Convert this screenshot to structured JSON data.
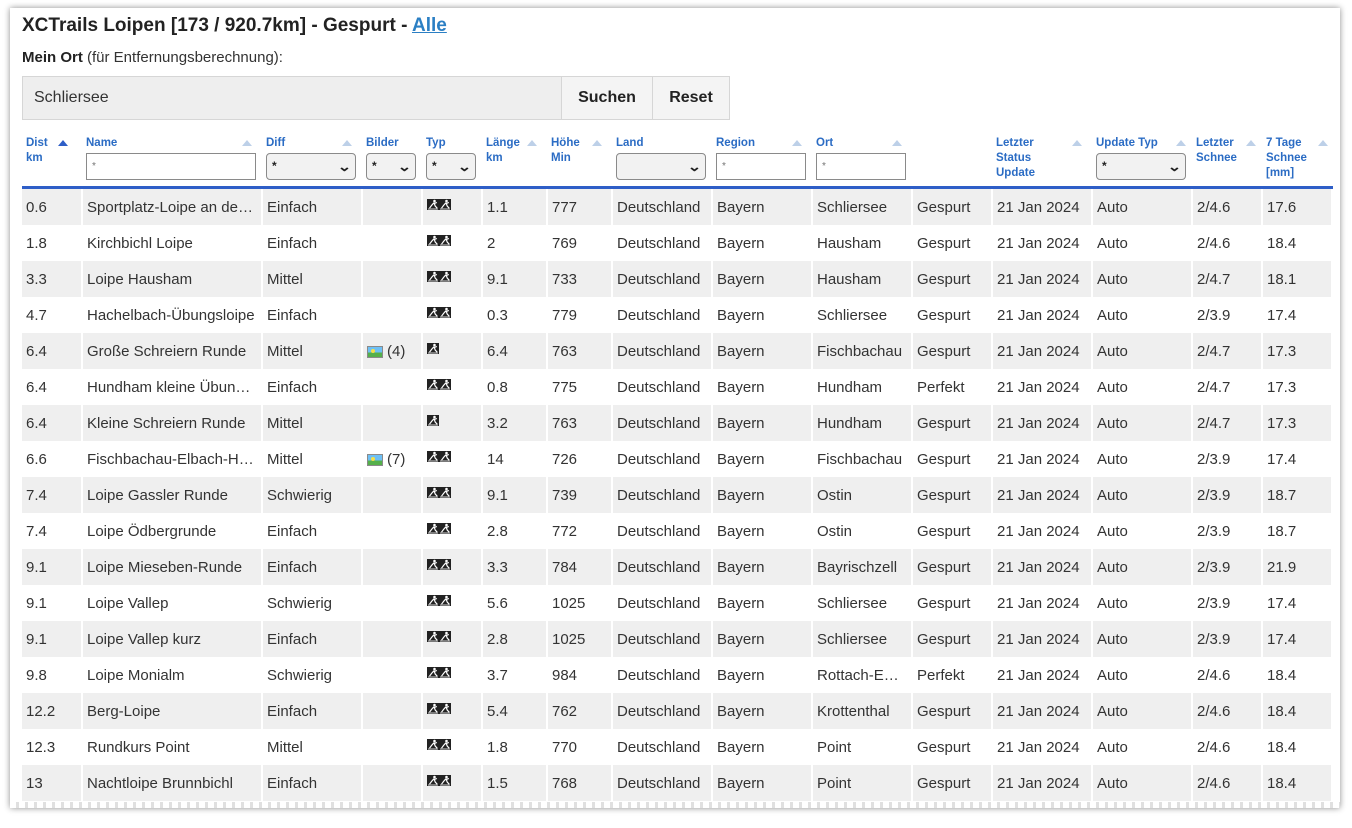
{
  "header": {
    "title_prefix": "XCTrails Loipen [173 / 920.7km] - Gespurt - ",
    "title_link": "Alle",
    "subtitle_bold": "Mein Ort",
    "subtitle_rest": " (für Entfernungsberechnung):"
  },
  "search": {
    "value": "Schliersee",
    "search_label": "Suchen",
    "reset_label": "Reset"
  },
  "columns": {
    "dist": "Dist km",
    "name": "Name",
    "diff": "Diff",
    "bilder": "Bilder",
    "typ": "Typ",
    "laenge": "Länge km",
    "hoehe": "Höhe Min",
    "land": "Land",
    "region": "Region",
    "ort": "Ort",
    "status": "",
    "update": "Letzter Status Update",
    "updatetyp": "Update Typ",
    "schnee": "Letzter Schnee",
    "tage": "7 Tage Schnee [mm]"
  },
  "filters": {
    "name_placeholder": "*",
    "diff_value": "*",
    "bilder_value": "*",
    "typ_value": "*",
    "land_value": "",
    "region_placeholder": "*",
    "ort_placeholder": "*",
    "updatetyp_value": "*"
  },
  "icons": {
    "sort": "sort-arrow-icon",
    "chevron": "chevron-down-icon",
    "classic": "classic-ski-icon",
    "skate": "skating-ski-icon",
    "image": "image-icon"
  },
  "colors": {
    "header_text": "#2b6cc4",
    "header_rule": "#2e5ec7",
    "link": "#2b7fc4",
    "row_alt": "#efefef"
  },
  "rows": [
    {
      "dist": "0.6",
      "name": "Sportplatz-Loipe an de…",
      "diff": "Einfach",
      "bilder": "",
      "typ": "both",
      "laenge": "1.1",
      "hoehe": "777",
      "land": "Deutschland",
      "region": "Bayern",
      "ort": "Schliersee",
      "status": "Gespurt",
      "update": "21 Jan 2024",
      "updatetyp": "Auto",
      "schnee": "2/4.6",
      "tage": "17.6"
    },
    {
      "dist": "1.8",
      "name": "Kirchbichl Loipe",
      "diff": "Einfach",
      "bilder": "",
      "typ": "both",
      "laenge": "2",
      "hoehe": "769",
      "land": "Deutschland",
      "region": "Bayern",
      "ort": "Hausham",
      "status": "Gespurt",
      "update": "21 Jan 2024",
      "updatetyp": "Auto",
      "schnee": "2/4.6",
      "tage": "18.4"
    },
    {
      "dist": "3.3",
      "name": "Loipe Hausham",
      "diff": "Mittel",
      "bilder": "",
      "typ": "both",
      "laenge": "9.1",
      "hoehe": "733",
      "land": "Deutschland",
      "region": "Bayern",
      "ort": "Hausham",
      "status": "Gespurt",
      "update": "21 Jan 2024",
      "updatetyp": "Auto",
      "schnee": "2/4.7",
      "tage": "18.1"
    },
    {
      "dist": "4.7",
      "name": "Hachelbach-Übungsloipe",
      "diff": "Einfach",
      "bilder": "",
      "typ": "both",
      "laenge": "0.3",
      "hoehe": "779",
      "land": "Deutschland",
      "region": "Bayern",
      "ort": "Schliersee",
      "status": "Gespurt",
      "update": "21 Jan 2024",
      "updatetyp": "Auto",
      "schnee": "2/3.9",
      "tage": "17.4"
    },
    {
      "dist": "6.4",
      "name": "Große Schreiern Runde",
      "diff": "Mittel",
      "bilder": "(4)",
      "typ": "classic",
      "laenge": "6.4",
      "hoehe": "763",
      "land": "Deutschland",
      "region": "Bayern",
      "ort": "Fischbachau",
      "status": "Gespurt",
      "update": "21 Jan 2024",
      "updatetyp": "Auto",
      "schnee": "2/4.7",
      "tage": "17.3"
    },
    {
      "dist": "6.4",
      "name": "Hundham kleine Übun…",
      "diff": "Einfach",
      "bilder": "",
      "typ": "both",
      "laenge": "0.8",
      "hoehe": "775",
      "land": "Deutschland",
      "region": "Bayern",
      "ort": "Hundham",
      "status": "Perfekt",
      "update": "21 Jan 2024",
      "updatetyp": "Auto",
      "schnee": "2/4.7",
      "tage": "17.3"
    },
    {
      "dist": "6.4",
      "name": "Kleine Schreiern Runde",
      "diff": "Mittel",
      "bilder": "",
      "typ": "classic",
      "laenge": "3.2",
      "hoehe": "763",
      "land": "Deutschland",
      "region": "Bayern",
      "ort": "Hundham",
      "status": "Gespurt",
      "update": "21 Jan 2024",
      "updatetyp": "Auto",
      "schnee": "2/4.7",
      "tage": "17.3"
    },
    {
      "dist": "6.6",
      "name": "Fischbachau-Elbach-H…",
      "diff": "Mittel",
      "bilder": "(7)",
      "typ": "both",
      "laenge": "14",
      "hoehe": "726",
      "land": "Deutschland",
      "region": "Bayern",
      "ort": "Fischbachau",
      "status": "Gespurt",
      "update": "21 Jan 2024",
      "updatetyp": "Auto",
      "schnee": "2/3.9",
      "tage": "17.4"
    },
    {
      "dist": "7.4",
      "name": "Loipe Gassler Runde",
      "diff": "Schwierig",
      "bilder": "",
      "typ": "both",
      "laenge": "9.1",
      "hoehe": "739",
      "land": "Deutschland",
      "region": "Bayern",
      "ort": "Ostin",
      "status": "Gespurt",
      "update": "21 Jan 2024",
      "updatetyp": "Auto",
      "schnee": "2/3.9",
      "tage": "18.7"
    },
    {
      "dist": "7.4",
      "name": "Loipe Ödbergrunde",
      "diff": "Einfach",
      "bilder": "",
      "typ": "both",
      "laenge": "2.8",
      "hoehe": "772",
      "land": "Deutschland",
      "region": "Bayern",
      "ort": "Ostin",
      "status": "Gespurt",
      "update": "21 Jan 2024",
      "updatetyp": "Auto",
      "schnee": "2/3.9",
      "tage": "18.7"
    },
    {
      "dist": "9.1",
      "name": "Loipe Mieseben-Runde",
      "diff": "Einfach",
      "bilder": "",
      "typ": "both",
      "laenge": "3.3",
      "hoehe": "784",
      "land": "Deutschland",
      "region": "Bayern",
      "ort": "Bayrischzell",
      "status": "Gespurt",
      "update": "21 Jan 2024",
      "updatetyp": "Auto",
      "schnee": "2/3.9",
      "tage": "21.9"
    },
    {
      "dist": "9.1",
      "name": "Loipe Vallep",
      "diff": "Schwierig",
      "bilder": "",
      "typ": "both",
      "laenge": "5.6",
      "hoehe": "1025",
      "land": "Deutschland",
      "region": "Bayern",
      "ort": "Schliersee",
      "status": "Gespurt",
      "update": "21 Jan 2024",
      "updatetyp": "Auto",
      "schnee": "2/3.9",
      "tage": "17.4"
    },
    {
      "dist": "9.1",
      "name": "Loipe Vallep kurz",
      "diff": "Einfach",
      "bilder": "",
      "typ": "both",
      "laenge": "2.8",
      "hoehe": "1025",
      "land": "Deutschland",
      "region": "Bayern",
      "ort": "Schliersee",
      "status": "Gespurt",
      "update": "21 Jan 2024",
      "updatetyp": "Auto",
      "schnee": "2/3.9",
      "tage": "17.4"
    },
    {
      "dist": "9.8",
      "name": "Loipe Monialm",
      "diff": "Schwierig",
      "bilder": "",
      "typ": "both",
      "laenge": "3.7",
      "hoehe": "984",
      "land": "Deutschland",
      "region": "Bayern",
      "ort": "Rottach-E…",
      "status": "Perfekt",
      "update": "21 Jan 2024",
      "updatetyp": "Auto",
      "schnee": "2/4.6",
      "tage": "18.4"
    },
    {
      "dist": "12.2",
      "name": "Berg-Loipe",
      "diff": "Einfach",
      "bilder": "",
      "typ": "both",
      "laenge": "5.4",
      "hoehe": "762",
      "land": "Deutschland",
      "region": "Bayern",
      "ort": "Krottenthal",
      "status": "Gespurt",
      "update": "21 Jan 2024",
      "updatetyp": "Auto",
      "schnee": "2/4.6",
      "tage": "18.4"
    },
    {
      "dist": "12.3",
      "name": "Rundkurs Point",
      "diff": "Mittel",
      "bilder": "",
      "typ": "both",
      "laenge": "1.8",
      "hoehe": "770",
      "land": "Deutschland",
      "region": "Bayern",
      "ort": "Point",
      "status": "Gespurt",
      "update": "21 Jan 2024",
      "updatetyp": "Auto",
      "schnee": "2/4.6",
      "tage": "18.4"
    },
    {
      "dist": "13",
      "name": "Nachtloipe Brunnbichl",
      "diff": "Einfach",
      "bilder": "",
      "typ": "both",
      "laenge": "1.5",
      "hoehe": "768",
      "land": "Deutschland",
      "region": "Bayern",
      "ort": "Point",
      "status": "Gespurt",
      "update": "21 Jan 2024",
      "updatetyp": "Auto",
      "schnee": "2/4.6",
      "tage": "18.4"
    }
  ]
}
